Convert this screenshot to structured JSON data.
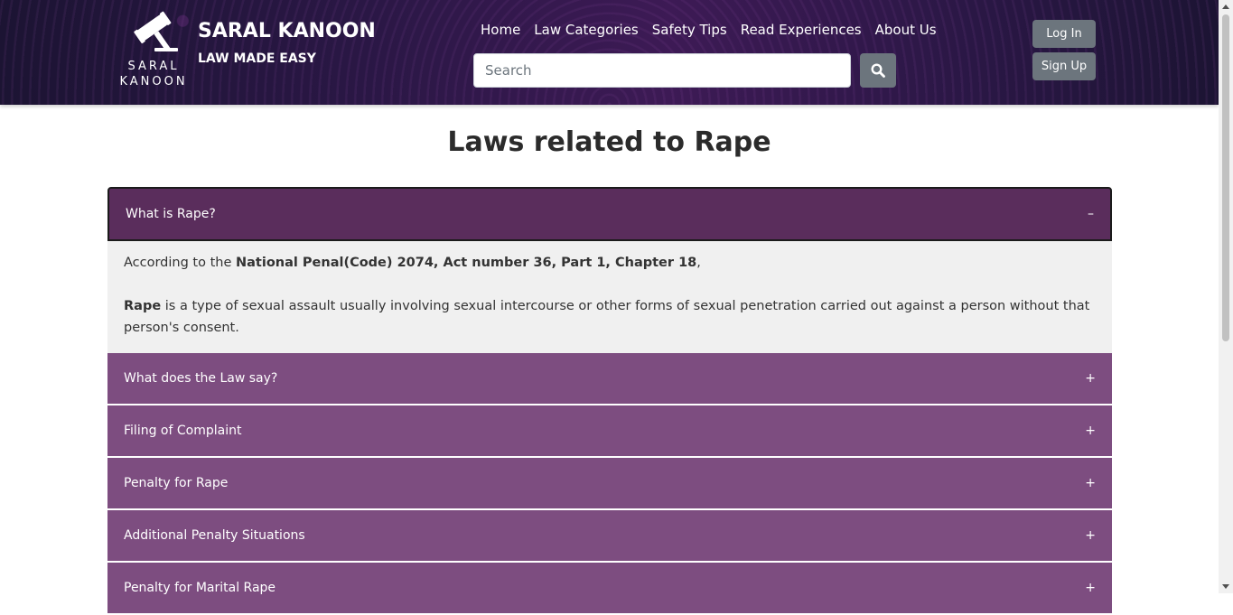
{
  "brand": {
    "logo_text_line1": "SARAL",
    "logo_text_line2": "KANOON",
    "title": "SARAL KANOON",
    "tagline": "LAW MADE EASY"
  },
  "nav": {
    "items": [
      "Home",
      "Law Categories",
      "Safety Tips",
      "Read Experiences",
      "About Us"
    ]
  },
  "search": {
    "placeholder": "Search",
    "icon": "search-icon"
  },
  "auth": {
    "login_label": "Log In",
    "signup_label": "Sign Up"
  },
  "page": {
    "title": "Laws related to Rape"
  },
  "accordion": {
    "active": {
      "label": "What is Rape?",
      "toggle": "–",
      "intro_prefix": "According to the ",
      "intro_bold": "National Penal(Code) 2074, Act number 36, Part 1, Chapter 18",
      "intro_suffix": ",",
      "def_bold": "Rape",
      "def_text": " is a type of sexual assault usually involving sexual intercourse or other forms of sexual penetration carried out against a person without that person's consent."
    },
    "items": [
      {
        "label": "What does the Law say?",
        "toggle": "+"
      },
      {
        "label": "Filing of Complaint",
        "toggle": "+"
      },
      {
        "label": "Penalty for Rape",
        "toggle": "+"
      },
      {
        "label": "Additional Penalty Situations",
        "toggle": "+"
      },
      {
        "label": "Penalty for Marital Rape",
        "toggle": "+"
      }
    ]
  },
  "colors": {
    "accordion_item": "#7d4d80",
    "accordion_active": "#5a2d5c",
    "button_gray": "#6c757d"
  }
}
